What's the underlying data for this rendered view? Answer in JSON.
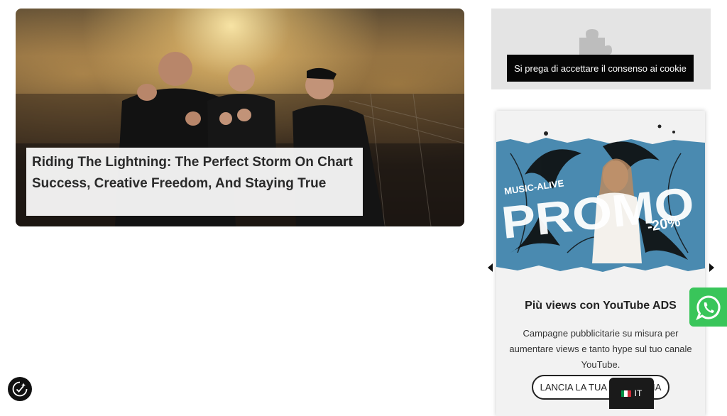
{
  "feature": {
    "title": "Riding The Lightning: The Perfect Storm On Chart Success, Creative Freedom, And Staying True"
  },
  "cookie": {
    "button_label": "Si prega di accettare il consenso ai cookie"
  },
  "promo": {
    "banner_brand": "MUSIC-ALIVE",
    "banner_word": "PROMO",
    "banner_discount": "-20%",
    "title": "Più views con YouTube ADS",
    "description": "Campagne pubblicitarie su misura per aumentare views e tanto hype sul tuo canale YouTube.",
    "cta_label": "LANCIA LA TUA CAMPAGNA"
  },
  "language": {
    "code": "IT"
  },
  "colors": {
    "whatsapp": "#39c55a",
    "promo_blue": "#4a8ab0",
    "cookie_button": "#050505"
  },
  "icons": [
    "chevron-left-icon",
    "chevron-right-icon",
    "whatsapp-icon",
    "italy-flag-icon",
    "privacy-settings-icon",
    "puzzle-icon"
  ]
}
